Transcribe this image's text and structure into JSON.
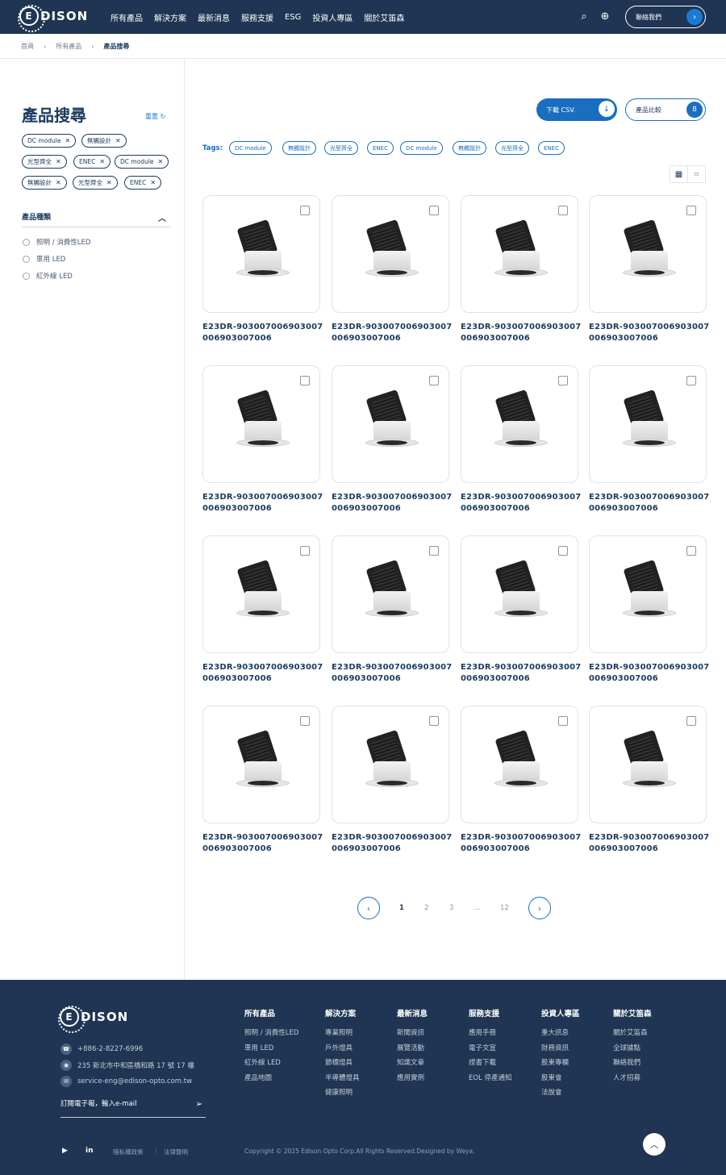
{
  "brand": {
    "logo_letter": "E",
    "logo_text": "DISON"
  },
  "nav": {
    "items": [
      "所有產品",
      "解決方案",
      "最新消息",
      "服務支援",
      "ESG",
      "投資人專區",
      "關於艾笛森"
    ],
    "contact_label": "聯絡我們",
    "contact_arrow": "›",
    "search_icon": "⌕",
    "globe_icon": "⊕"
  },
  "breadcrumb": {
    "items": [
      "首頁",
      "所有產品",
      "產品搜尋"
    ],
    "sep": "›"
  },
  "sidebar": {
    "title": "產品搜尋",
    "reset_label": "重置 ↻",
    "chips": [
      "DC module",
      "無觸設計",
      "光型齊全",
      "ENEC",
      "DC module",
      "無觸設計",
      "光型齊全",
      "ENEC"
    ],
    "chip_close": "✕",
    "category_title": "產品種類",
    "category_chevron": "︿",
    "categories": [
      "照明 / 消費性LED",
      "車用 LED",
      "紅外線 LED"
    ]
  },
  "toolbar": {
    "csv_label": "下載 CSV.",
    "csv_icon": "↓",
    "compare_label": "產品比較",
    "compare_count": "8",
    "tags_label": "Tags:",
    "tags": [
      "DC module",
      "無觸設計",
      "光型齊全",
      "ENEC",
      "DC module",
      "無觸設計",
      "光型齊全",
      "ENEC"
    ],
    "grid_icon": "▦",
    "list_icon": "≡"
  },
  "products": {
    "name": "E23DR-903007006903007006903007006"
  },
  "pagination": {
    "prev": "‹",
    "next": "›",
    "pages": [
      "1",
      "2",
      "3",
      "...",
      "12"
    ],
    "current": "1"
  },
  "footer": {
    "phone": "+886-2-8227-6996",
    "address": "235 新北市中和區橋和路 17 號 17 樓",
    "email": "service-eng@edison-opto.com.tw",
    "subscribe_placeholder": "訂閱電子報，輸入e-mail",
    "send_icon": "➢",
    "columns": [
      {
        "title": "所有產品",
        "links": [
          "照明 / 消費性LED",
          "車用 LED",
          "紅外線 LED",
          "產品地圖"
        ]
      },
      {
        "title": "解決方案",
        "links": [
          "專業照明",
          "戶外燈具",
          "節標燈具",
          "半導體燈具",
          "健康照明"
        ]
      },
      {
        "title": "最新消息",
        "links": [
          "新聞資訊",
          "展覽活動",
          "知識文章",
          "應用實例"
        ]
      },
      {
        "title": "服務支援",
        "links": [
          "應用手冊",
          "電子文宣",
          "證書下載",
          "EOL 停產通知"
        ]
      },
      {
        "title": "投資人專區",
        "links": [
          "重大訊息",
          "財務資訊",
          "股東專欄",
          "股東會",
          "法說會"
        ]
      },
      {
        "title": "關於艾笛森",
        "links": [
          "關於艾笛森",
          "全球據點",
          "聯絡我們",
          "人才招募"
        ]
      }
    ],
    "youtube_icon": "▶",
    "linkedin_icon": "in",
    "privacy": "隱私權政策",
    "legal": "法律聲明",
    "copyright": "Copyright © 2025 Edison Opto Corp.All Rights Reserved.Designed by Weya.",
    "top_icon": "︿"
  }
}
